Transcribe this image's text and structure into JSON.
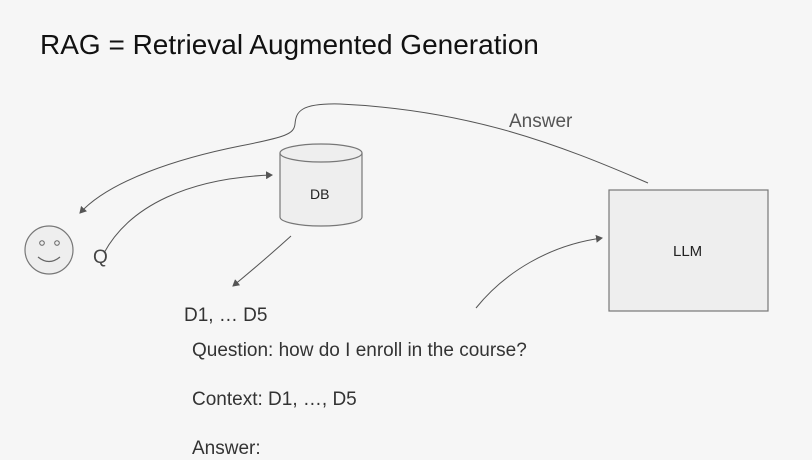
{
  "title": "RAG = Retrieval Augmented Generation",
  "diagram": {
    "user_icon": "smiley-face-icon",
    "query_label": "Q",
    "database_label": "DB",
    "documents_label": "D1, … D5",
    "llm_label": "LLM",
    "answer_label": "Answer"
  },
  "prompt": {
    "question": "Question: how do I enroll in the course?",
    "context": "Context: D1, …, D5",
    "answer": "Answer:"
  },
  "colors": {
    "background": "#f6f6f6",
    "shape_fill": "#eeeeee",
    "stroke": "#555555"
  }
}
